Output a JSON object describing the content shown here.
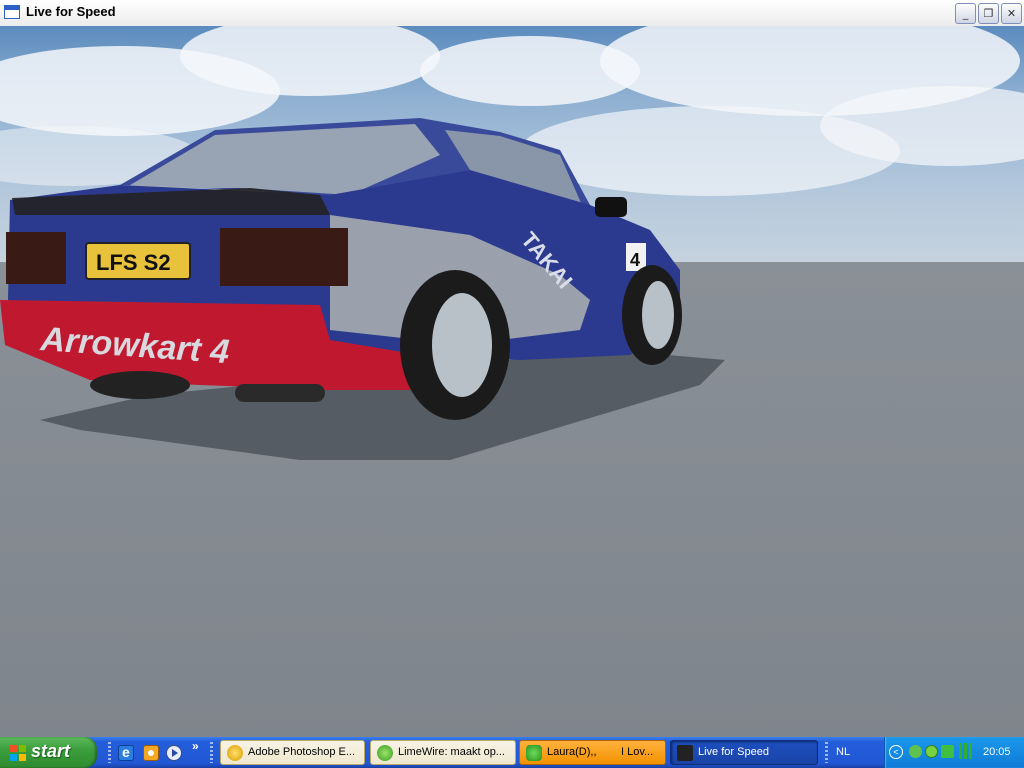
{
  "window": {
    "title": "Live for Speed",
    "minimize_icon": "minimize-icon",
    "maximize_icon": "restore-icon",
    "close_icon": "close-icon"
  },
  "scene": {
    "license_plate": "LFS S2",
    "livery_text": "Arrowkart 4",
    "side_text": "TAKAI",
    "door_number": "4",
    "sky_color": "#8fb0d2",
    "ground_color": "#858b92",
    "car_body_color": "#2b3a8f",
    "car_bumper_color": "#c0182f"
  },
  "taskbar": {
    "start_label": "start",
    "quick_launch": [
      "internet-explorer-icon",
      "outlook-icon",
      "media-player-icon"
    ],
    "quick_launch_more": "»",
    "tasks": [
      {
        "label": "Adobe Photoshop E...",
        "icon": "photoshop-icon"
      },
      {
        "label": "LimeWire: maakt op...",
        "icon": "limewire-icon"
      },
      {
        "label": "Laura(D),,        I Lov...",
        "icon": "messenger-icon"
      },
      {
        "label": "Live for Speed",
        "icon": "lfs-icon"
      }
    ],
    "language": "NL",
    "clock": "20:05"
  }
}
